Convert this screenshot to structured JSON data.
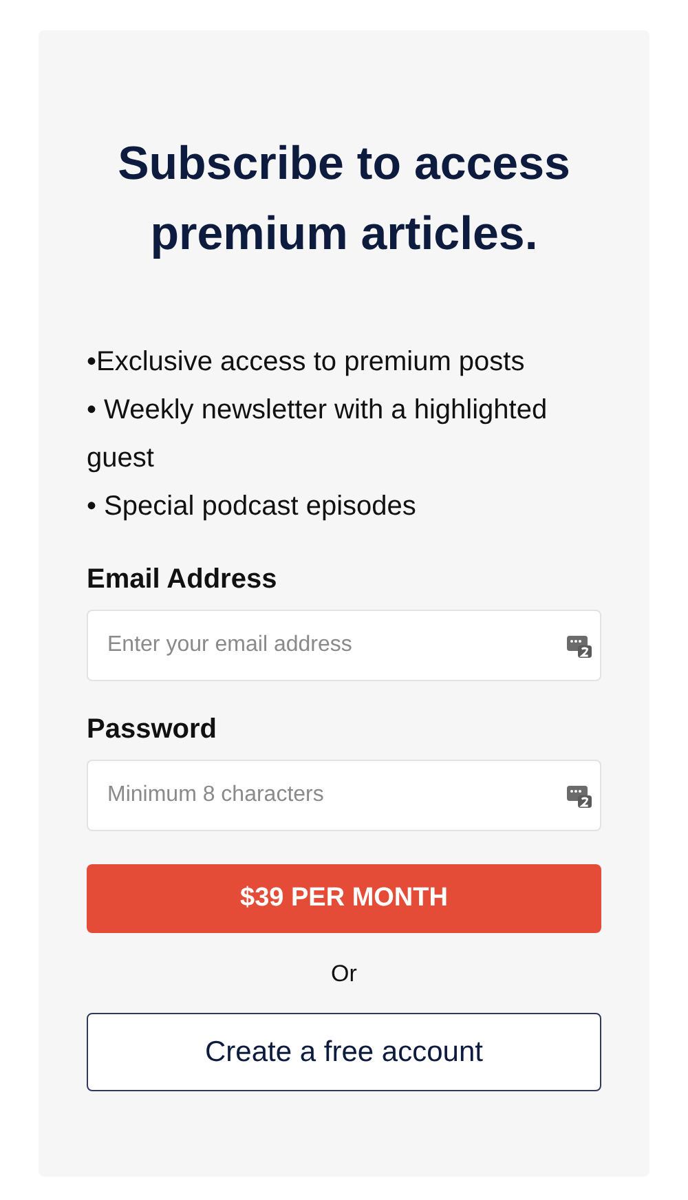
{
  "title": "Subscribe to access premium articles.",
  "benefits": [
    "•Exclusive access to premium posts",
    "• Weekly newsletter with a highlighted guest",
    "• Special podcast episodes"
  ],
  "fields": [
    {
      "label": "Email Address",
      "placeholder": "Enter your email address"
    },
    {
      "label": "Password",
      "placeholder": "Minimum 8 characters"
    }
  ],
  "subscribe_button": "$39 PER MONTH",
  "separator": "Or",
  "free_account_button": "Create a free account"
}
